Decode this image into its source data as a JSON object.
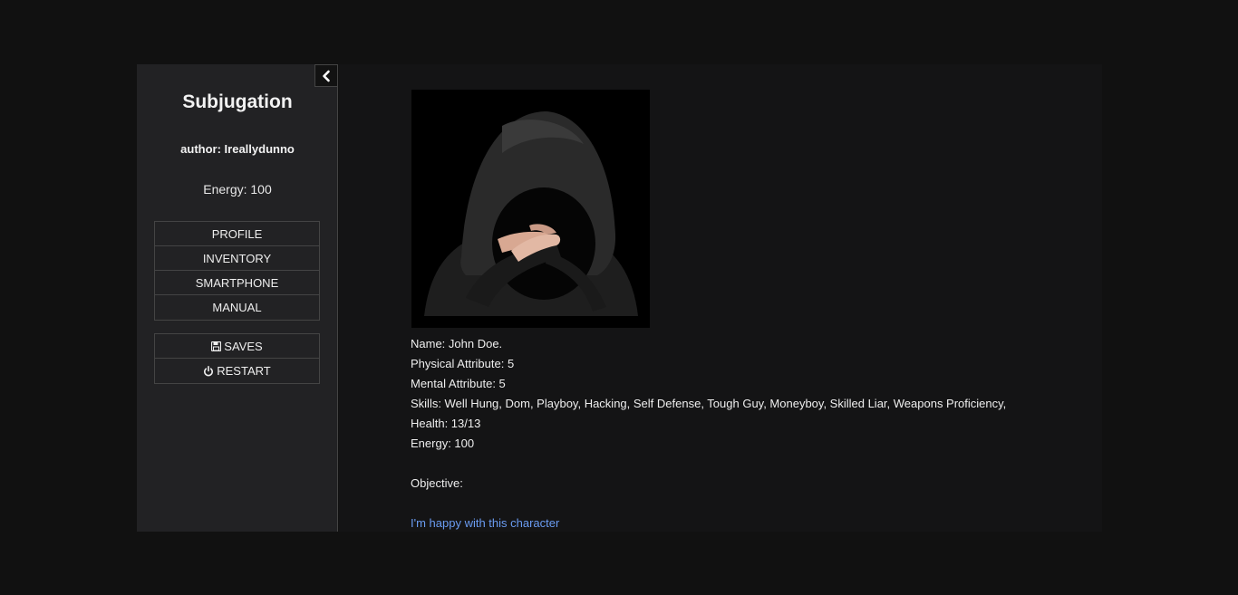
{
  "sidebar": {
    "title": "Subjugation",
    "author": "author: Ireallydunno",
    "energy": "Energy: 100",
    "menu": {
      "profile": "PROFILE",
      "inventory": "INVENTORY",
      "smartphone": "SMARTPHONE",
      "manual": "MANUAL"
    },
    "actions": {
      "saves": "SAVES",
      "restart": "RESTART"
    },
    "toggle_icon": "chevron-left-icon"
  },
  "main": {
    "portrait_icon": "hooded-figure-image",
    "stats": {
      "name": "Name: John Doe.",
      "physical": "Physical Attribute: 5",
      "mental": "Mental Attribute: 5",
      "skills": "Skills: Well Hung, Dom, Playboy, Hacking, Self Defense, Tough Guy, Moneyboy, Skilled Liar, Weapons Proficiency,",
      "health": "Health: 13/13",
      "energy": "Energy: 100",
      "objective": "Objective:"
    },
    "confirm_link": "I'm happy with this character"
  },
  "colors": {
    "background": "#111111",
    "sidebar": "#222224",
    "main": "#141415",
    "link": "#6a9cf2"
  }
}
